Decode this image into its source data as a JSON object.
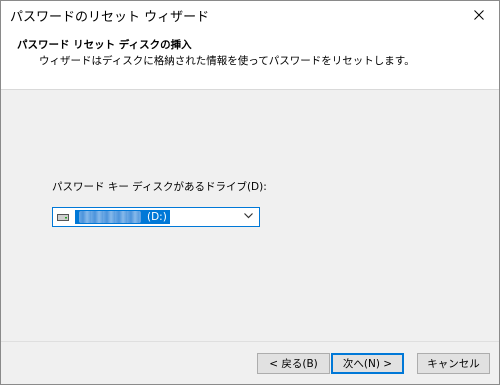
{
  "window": {
    "title": "パスワードのリセット ウィザード",
    "close_icon": "close-icon"
  },
  "header": {
    "title": "パスワード リセット ディスクの挿入",
    "subtitle": "ウィザードはディスクに格納された情報を使ってパスワードをリセットします。"
  },
  "form": {
    "drive_label": "パスワード キー ディスクがあるドライブ(D):",
    "drive_value": "(D:)",
    "drive_icon": "drive-icon"
  },
  "buttons": {
    "back": "< 戻る(B)",
    "next": "次へ(N) >",
    "cancel": "キャンセル"
  },
  "colors": {
    "accent": "#0078d7",
    "button_bg": "#e1e1e1",
    "dialog_bg": "#f0f0f0"
  }
}
